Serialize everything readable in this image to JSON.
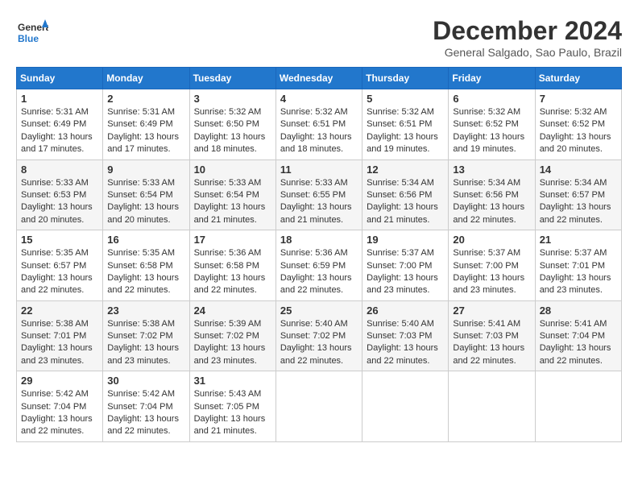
{
  "logo": {
    "general": "General",
    "blue": "Blue"
  },
  "title": "December 2024",
  "subtitle": "General Salgado, Sao Paulo, Brazil",
  "days_header": [
    "Sunday",
    "Monday",
    "Tuesday",
    "Wednesday",
    "Thursday",
    "Friday",
    "Saturday"
  ],
  "weeks": [
    [
      {
        "day": "1",
        "sunrise": "5:31 AM",
        "sunset": "6:49 PM",
        "daylight": "13 hours and 17 minutes."
      },
      {
        "day": "2",
        "sunrise": "5:31 AM",
        "sunset": "6:49 PM",
        "daylight": "13 hours and 17 minutes."
      },
      {
        "day": "3",
        "sunrise": "5:32 AM",
        "sunset": "6:50 PM",
        "daylight": "13 hours and 18 minutes."
      },
      {
        "day": "4",
        "sunrise": "5:32 AM",
        "sunset": "6:51 PM",
        "daylight": "13 hours and 18 minutes."
      },
      {
        "day": "5",
        "sunrise": "5:32 AM",
        "sunset": "6:51 PM",
        "daylight": "13 hours and 19 minutes."
      },
      {
        "day": "6",
        "sunrise": "5:32 AM",
        "sunset": "6:52 PM",
        "daylight": "13 hours and 19 minutes."
      },
      {
        "day": "7",
        "sunrise": "5:32 AM",
        "sunset": "6:52 PM",
        "daylight": "13 hours and 20 minutes."
      }
    ],
    [
      {
        "day": "8",
        "sunrise": "5:33 AM",
        "sunset": "6:53 PM",
        "daylight": "13 hours and 20 minutes."
      },
      {
        "day": "9",
        "sunrise": "5:33 AM",
        "sunset": "6:54 PM",
        "daylight": "13 hours and 20 minutes."
      },
      {
        "day": "10",
        "sunrise": "5:33 AM",
        "sunset": "6:54 PM",
        "daylight": "13 hours and 21 minutes."
      },
      {
        "day": "11",
        "sunrise": "5:33 AM",
        "sunset": "6:55 PM",
        "daylight": "13 hours and 21 minutes."
      },
      {
        "day": "12",
        "sunrise": "5:34 AM",
        "sunset": "6:56 PM",
        "daylight": "13 hours and 21 minutes."
      },
      {
        "day": "13",
        "sunrise": "5:34 AM",
        "sunset": "6:56 PM",
        "daylight": "13 hours and 22 minutes."
      },
      {
        "day": "14",
        "sunrise": "5:34 AM",
        "sunset": "6:57 PM",
        "daylight": "13 hours and 22 minutes."
      }
    ],
    [
      {
        "day": "15",
        "sunrise": "5:35 AM",
        "sunset": "6:57 PM",
        "daylight": "13 hours and 22 minutes."
      },
      {
        "day": "16",
        "sunrise": "5:35 AM",
        "sunset": "6:58 PM",
        "daylight": "13 hours and 22 minutes."
      },
      {
        "day": "17",
        "sunrise": "5:36 AM",
        "sunset": "6:58 PM",
        "daylight": "13 hours and 22 minutes."
      },
      {
        "day": "18",
        "sunrise": "5:36 AM",
        "sunset": "6:59 PM",
        "daylight": "13 hours and 22 minutes."
      },
      {
        "day": "19",
        "sunrise": "5:37 AM",
        "sunset": "7:00 PM",
        "daylight": "13 hours and 23 minutes."
      },
      {
        "day": "20",
        "sunrise": "5:37 AM",
        "sunset": "7:00 PM",
        "daylight": "13 hours and 23 minutes."
      },
      {
        "day": "21",
        "sunrise": "5:37 AM",
        "sunset": "7:01 PM",
        "daylight": "13 hours and 23 minutes."
      }
    ],
    [
      {
        "day": "22",
        "sunrise": "5:38 AM",
        "sunset": "7:01 PM",
        "daylight": "13 hours and 23 minutes."
      },
      {
        "day": "23",
        "sunrise": "5:38 AM",
        "sunset": "7:02 PM",
        "daylight": "13 hours and 23 minutes."
      },
      {
        "day": "24",
        "sunrise": "5:39 AM",
        "sunset": "7:02 PM",
        "daylight": "13 hours and 23 minutes."
      },
      {
        "day": "25",
        "sunrise": "5:40 AM",
        "sunset": "7:02 PM",
        "daylight": "13 hours and 22 minutes."
      },
      {
        "day": "26",
        "sunrise": "5:40 AM",
        "sunset": "7:03 PM",
        "daylight": "13 hours and 22 minutes."
      },
      {
        "day": "27",
        "sunrise": "5:41 AM",
        "sunset": "7:03 PM",
        "daylight": "13 hours and 22 minutes."
      },
      {
        "day": "28",
        "sunrise": "5:41 AM",
        "sunset": "7:04 PM",
        "daylight": "13 hours and 22 minutes."
      }
    ],
    [
      {
        "day": "29",
        "sunrise": "5:42 AM",
        "sunset": "7:04 PM",
        "daylight": "13 hours and 22 minutes."
      },
      {
        "day": "30",
        "sunrise": "5:42 AM",
        "sunset": "7:04 PM",
        "daylight": "13 hours and 22 minutes."
      },
      {
        "day": "31",
        "sunrise": "5:43 AM",
        "sunset": "7:05 PM",
        "daylight": "13 hours and 21 minutes."
      },
      null,
      null,
      null,
      null
    ]
  ],
  "labels": {
    "sunrise": "Sunrise:",
    "sunset": "Sunset:",
    "daylight": "Daylight hours"
  }
}
